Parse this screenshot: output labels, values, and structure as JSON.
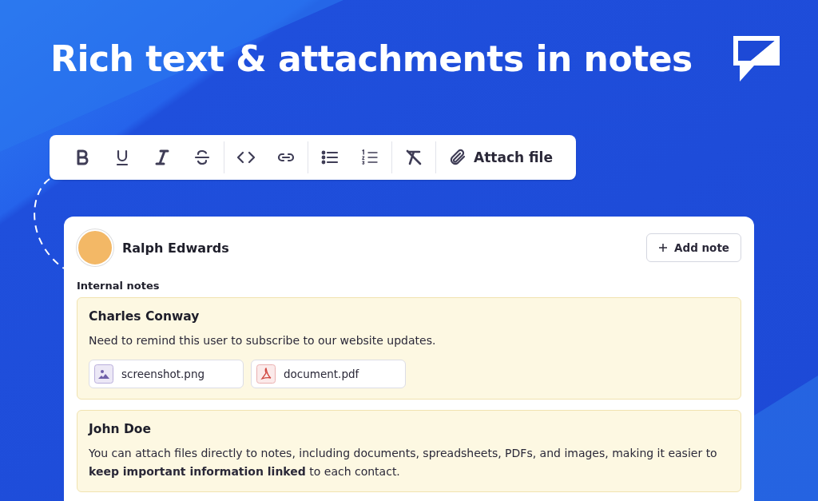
{
  "headline": "Rich text & attachments in notes",
  "toolbar": {
    "groups": [
      [
        {
          "kind": "bold"
        },
        {
          "kind": "underline"
        },
        {
          "kind": "italic"
        },
        {
          "kind": "strikethrough"
        }
      ],
      [
        {
          "kind": "code"
        },
        {
          "kind": "link"
        }
      ],
      [
        {
          "kind": "bullet-list"
        },
        {
          "kind": "numbered-list"
        }
      ],
      [
        {
          "kind": "clear-format"
        }
      ],
      [
        {
          "kind": "attach",
          "label": "Attach file"
        }
      ]
    ]
  },
  "contact": {
    "name": "Ralph Edwards",
    "add_button": "Add note",
    "section_label": "Internal notes"
  },
  "notes": [
    {
      "author": "Charles Conway",
      "text": "Need to remind this user to subscribe to our website updates.",
      "attachments": [
        {
          "name": "screenshot.png",
          "kind": "image"
        },
        {
          "name": "document.pdf",
          "kind": "pdf"
        }
      ]
    },
    {
      "author": "John Doe",
      "text": "You can attach files directly to notes, including documents, spreadsheets, PDFs, and images, making it easier to **keep important information linked** to each contact."
    }
  ]
}
